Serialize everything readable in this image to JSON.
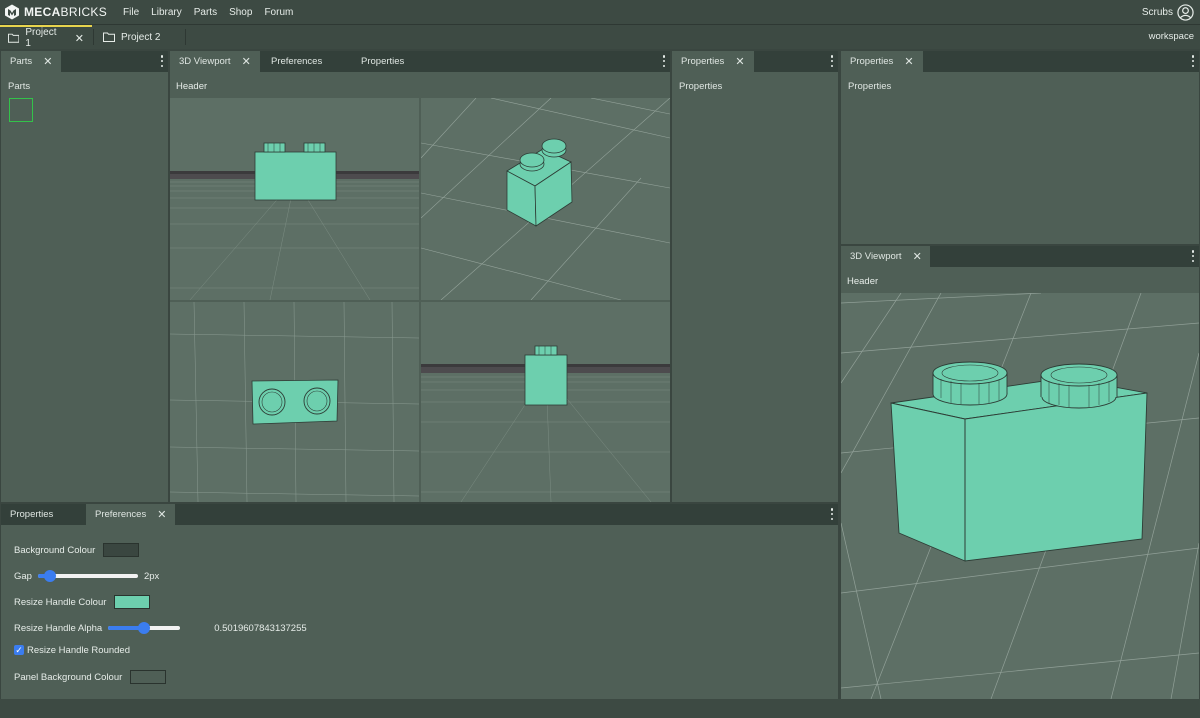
{
  "brand": {
    "name_bold": "MECA",
    "name_rest": "BRICKS",
    "logo_icon": "mecabricks-logo-icon"
  },
  "menu": [
    "File",
    "Library",
    "Parts",
    "Shop",
    "Forum"
  ],
  "user": {
    "name": "Scrubs",
    "icon": "user-circle-icon"
  },
  "projects": [
    {
      "label": "Project 1",
      "close": "✕"
    },
    {
      "label": "Project 2"
    }
  ],
  "workspace_label": "workspace",
  "parts_panel": {
    "tab": "Parts",
    "close": "✕",
    "label": "Parts"
  },
  "viewport_panel": {
    "tabs": [
      "3D Viewport",
      "Preferences",
      "Properties"
    ],
    "close": "✕",
    "header": "Header",
    "brick_color": "#6dcfae",
    "background_color": "#5d6f65"
  },
  "properties_panel_1": {
    "tab": "Properties",
    "close": "✕",
    "label": "Properties"
  },
  "properties_panel_2": {
    "tab": "Properties",
    "close": "✕",
    "label": "Properties"
  },
  "viewport_panel_2": {
    "tab": "3D Viewport",
    "close": "✕",
    "header": "Header"
  },
  "bottom_panel": {
    "tabs": [
      "Properties",
      "Preferences"
    ],
    "close": "✕",
    "preferences": {
      "background_colour": {
        "label": "Background Colour",
        "value": "#3a4640"
      },
      "gap": {
        "label": "Gap",
        "value_text": "2px",
        "fraction": 0.12
      },
      "resize_handle_colour": {
        "label": "Resize Handle Colour",
        "value": "#6dcfae"
      },
      "resize_handle_alpha": {
        "label": "Resize Handle Alpha",
        "value_text": "0.5019607843137255",
        "fraction": 0.5
      },
      "resize_handle_rounded": {
        "label": "Resize Handle Rounded",
        "checked": true
      },
      "panel_background_colour": {
        "label": "Panel Background Colour",
        "value": "#4f5f56"
      }
    }
  },
  "accent_color": "#e8d44d",
  "slider_color": "#3b7df0"
}
